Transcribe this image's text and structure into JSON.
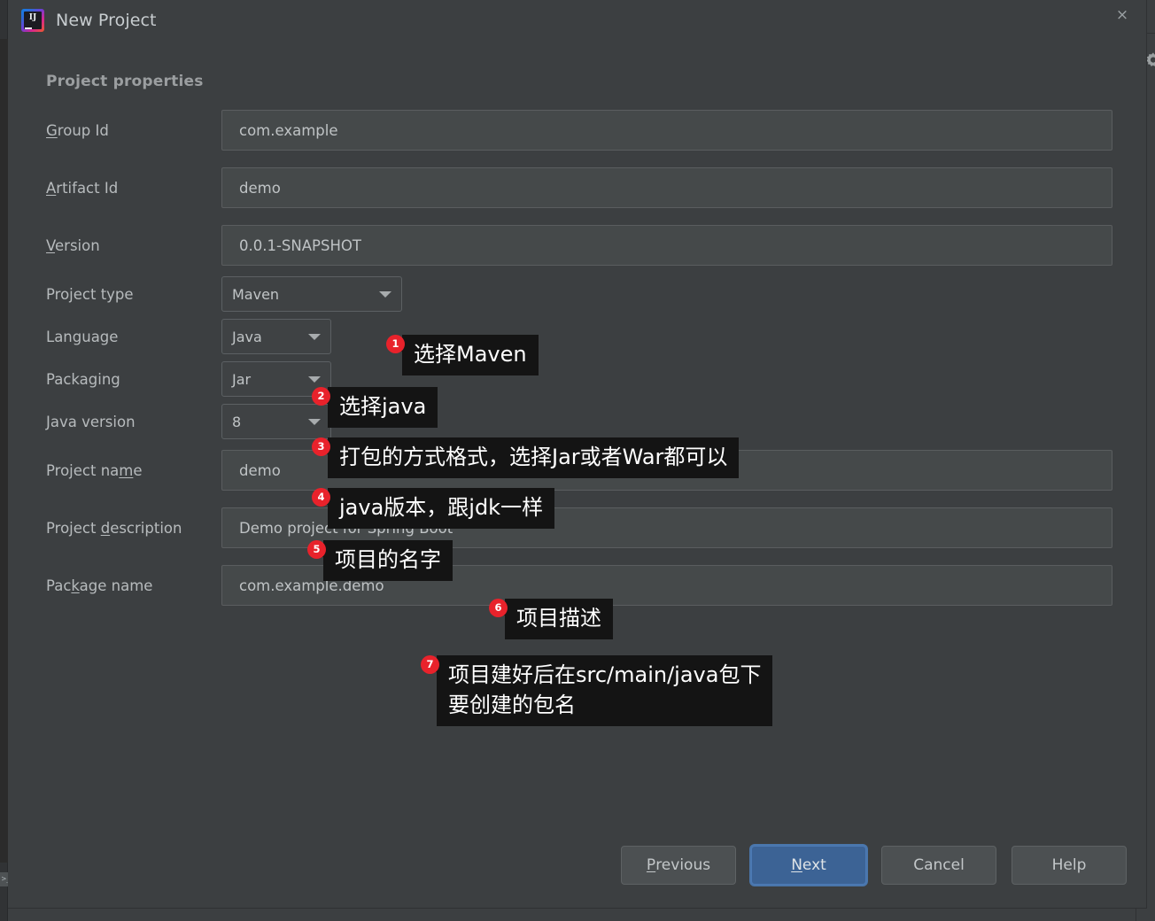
{
  "window": {
    "title": "New Project",
    "logo_text": "IJ",
    "close_label": "×"
  },
  "background": {
    "gear_icon": "gear-icon",
    "terminal_icon": ">_"
  },
  "dialog": {
    "section_heading": "Project properties",
    "fields": [
      {
        "label_pre": "",
        "label_key": "G",
        "label_post": "roup Id",
        "value": "com.example",
        "type": "text"
      },
      {
        "label_pre": "",
        "label_key": "A",
        "label_post": "rtifact Id",
        "value": "demo",
        "type": "text"
      },
      {
        "label_pre": "",
        "label_key": "V",
        "label_post": "ersion",
        "value": "0.0.1-SNAPSHOT",
        "type": "text"
      },
      {
        "label_pre": "Project type",
        "label_key": "",
        "label_post": "",
        "value": "Maven",
        "type": "select"
      },
      {
        "label_pre": "Language",
        "label_key": "",
        "label_post": "",
        "value": "Java",
        "type": "select"
      },
      {
        "label_pre": "Packaging",
        "label_key": "",
        "label_post": "",
        "value": "Jar",
        "type": "select"
      },
      {
        "label_pre": "Java version",
        "label_key": "",
        "label_post": "",
        "value": "8",
        "type": "select"
      },
      {
        "label_pre": "Project na",
        "label_key": "m",
        "label_post": "e",
        "value": "demo",
        "type": "text"
      },
      {
        "label_pre": "Project ",
        "label_key": "d",
        "label_post": "escription",
        "value": "Demo project for Spring Boot",
        "type": "text"
      },
      {
        "label_pre": "Pac",
        "label_key": "k",
        "label_post": "age name",
        "value": "com.example.demo",
        "type": "text"
      }
    ]
  },
  "annotations": [
    {
      "number": "1",
      "text": "选择Maven"
    },
    {
      "number": "2",
      "text": "选择java"
    },
    {
      "number": "3",
      "text": "打包的方式格式，选择Jar或者War都可以"
    },
    {
      "number": "4",
      "text": "java版本，跟jdk一样"
    },
    {
      "number": "5",
      "text": "项目的名字"
    },
    {
      "number": "6",
      "text": "项目描述"
    },
    {
      "number": "7",
      "line1": "项目建好后在src/main/java包下",
      "line2": "要创建的包名"
    }
  ],
  "footer": {
    "buttons": [
      {
        "pre": "",
        "key": "P",
        "post": "revious",
        "primary": false
      },
      {
        "pre": "",
        "key": "N",
        "post": "ext",
        "primary": true
      },
      {
        "pre": "Cancel",
        "key": "",
        "post": "",
        "primary": false
      },
      {
        "pre": "Help",
        "key": "",
        "post": "",
        "primary": false
      }
    ]
  },
  "colors": {
    "dialog_bg": "#3c3f41",
    "input_bg": "#45494a",
    "badge_red": "#e8222b",
    "tooltip_bg": "#141414",
    "primary_button": "#3c6395"
  }
}
